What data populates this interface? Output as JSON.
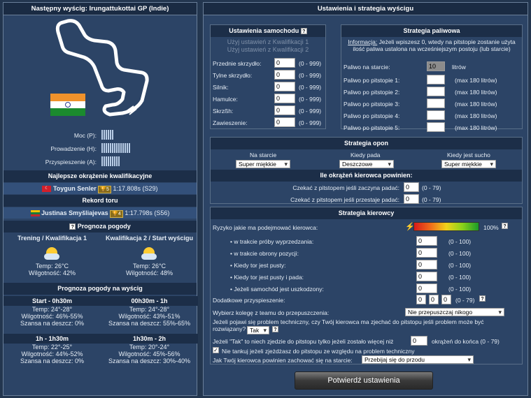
{
  "left": {
    "title": "Następny wyścig: Irungattukottai GP (Indie)",
    "stats": [
      {
        "label": "Moc (P):",
        "level": 6
      },
      {
        "label": "Prowadzenie (H):",
        "level": 14
      },
      {
        "label": "Przyspieszenie (A):",
        "level": 9
      }
    ],
    "best_quali_title": "Najlepsze okrążenie kwalifikacyjne",
    "best_quali": {
      "driver": "Toygun Senler",
      "badge": "5",
      "time": "1:17.808s",
      "season": "(S29)"
    },
    "record_title": "Rekord toru",
    "record": {
      "driver": "Justinas Smyšliajevas",
      "badge": "4",
      "time": "1:17.798s",
      "season": "(S56)"
    },
    "forecast_title": "Prognoza pogody",
    "forecast_cols": [
      {
        "title": "Trening / Kwalifikacja 1",
        "temp": "Temp: 26°C",
        "humidity": "Wilgotność: 42%"
      },
      {
        "title": "Kwalifikacja 2 / Start wyścigu",
        "temp": "Temp: 26°C",
        "humidity": "Wilgotność: 48%"
      }
    ],
    "race_forecast_title": "Prognoza pogody na wyścig",
    "race_forecast": [
      {
        "title": "Start - 0h30m",
        "temp": "Temp: 24°-28°",
        "humidity": "Wilgotność: 46%-55%",
        "rain": "Szansa na deszcz: 0%"
      },
      {
        "title": "00h30m - 1h",
        "temp": "Temp: 24°-28°",
        "humidity": "Wilgotność: 43%-51%",
        "rain": "Szansa na deszcz: 55%-65%"
      },
      {
        "title": "1h - 1h30m",
        "temp": "Temp: 22°-25°",
        "humidity": "Wilgotność: 44%-52%",
        "rain": "Szansa na deszcz: 0%"
      },
      {
        "title": "1h30m - 2h",
        "temp": "Temp: 20°-24°",
        "humidity": "Wilgotność: 45%-56%",
        "rain": "Szansa na deszcz: 30%-40%"
      }
    ]
  },
  "right": {
    "title": "Ustawienia i strategia wyścigu",
    "car": {
      "title": "Ustawienia samochodu",
      "q": "?",
      "btn1": "Użyj ustawień z Kwalifikacji 1",
      "btn2": "Użyj ustawień z Kwalifikacji 2",
      "rows": [
        {
          "label": "Przednie skrzydło:",
          "value": "0",
          "range": "(0 - 999)"
        },
        {
          "label": "Tylne skrzydło:",
          "value": "0",
          "range": "(0 - 999)"
        },
        {
          "label": "Silnik:",
          "value": "0",
          "range": "(0 - 999)"
        },
        {
          "label": "Hamulce:",
          "value": "0",
          "range": "(0 - 999)"
        },
        {
          "label": "Skrzßh:",
          "value": "0",
          "range": "(0 - 999)"
        },
        {
          "label": "Zawieszenie:",
          "value": "0",
          "range": "(0 - 999)"
        }
      ]
    },
    "fuel": {
      "title": "Strategia paliwowa",
      "info_link": "Informacja:",
      "info_text": "Jeżeli wpiszesz 0, wtedy na pitstopie zostanie użyta ilość paliwa ustalona na wcześniejszym postoju (lub starcie)",
      "start_label": "Paliwo na starcie:",
      "start_value": "10",
      "start_unit": "litrów",
      "rows": [
        {
          "label": "Paliwo po pitstopie 1:",
          "max": "(max 180 litrów)"
        },
        {
          "label": "Paliwo po pitstopie 2:",
          "max": "(max 180 litrów)"
        },
        {
          "label": "Paliwo po pitstopie 3:",
          "max": "(max 180 litrów)"
        },
        {
          "label": "Paliwo po pitstopie 4:",
          "max": "(max 180 litrów)"
        },
        {
          "label": "Paliwo po pitstopie 5:",
          "max": "(max 180 litrów)"
        }
      ]
    },
    "tyres": {
      "title": "Strategia opon",
      "cols": [
        "Na starcie",
        "Kiedy pada",
        "Kiedy jest sucho"
      ],
      "values": [
        "Super miękkie",
        "Deszczowe",
        "Super miękkie"
      ],
      "laps_title": "Ile okrążeń kierowca powinien:",
      "laps": [
        {
          "label": "Czekać z pitstopem jeśli zaczyna padać:",
          "value": "0",
          "range": "(0 - 79)"
        },
        {
          "label": "Czekać z pitstopem jeśli przestaje padać:",
          "value": "0",
          "range": "(0 - 79)"
        }
      ]
    },
    "driver": {
      "title": "Strategia kierowcy",
      "risk_label": "Ryzyko jakie ma podejmować kierowca:",
      "risk_value": "100%",
      "rows": [
        {
          "label": "• w trakcie próby wyprzedzania:",
          "value": "0",
          "range": "(0 - 100)"
        },
        {
          "label": "• w trakcie obrony pozycji:",
          "value": "0",
          "range": "(0 - 100)"
        },
        {
          "label": "• Kiedy tor jest pusty:",
          "value": "0",
          "range": "(0 - 100)"
        },
        {
          "label": "• Kiedy tor jest pusty i pada:",
          "value": "0",
          "range": "(0 - 100)"
        },
        {
          "label": "• Jeżeli samochód jest uszkodzony:",
          "value": "0",
          "range": "(0 - 100)"
        }
      ],
      "boost_label": "Dodatkowe przyspieszenie:",
      "boost_values": [
        "0",
        "0",
        "0"
      ],
      "boost_range": "(0 - 79)",
      "teammate_label": "Wybierz kolegę z teamu do przepuszczenia:",
      "teammate_value": "Nie przepuszczaj nikogo",
      "tech_label": "Jeżeli pojawi się problem techniczny, czy Twój kierowca ma zjechać do pitstopu jeśli problem może być rozwiązany?",
      "tech_value": "Tak",
      "tak_label": "Jeżeli \"Tak\" to niech zjedzie do pitstopu tylko jeżeli zostało więcej niż",
      "tak_value": "0",
      "tak_suffix": "okrążeń do końca (0 - 79)",
      "nofuel_label": "Nie tankuj jeżeli zjeżdżasz do pitstopu ze względu na problem techniczny",
      "start_label": "Jak Twój kierowca powinien zachować się na starcie:",
      "start_value": "Przebijaj się do przodu"
    },
    "submit": "Potwierdź ustawienia"
  }
}
